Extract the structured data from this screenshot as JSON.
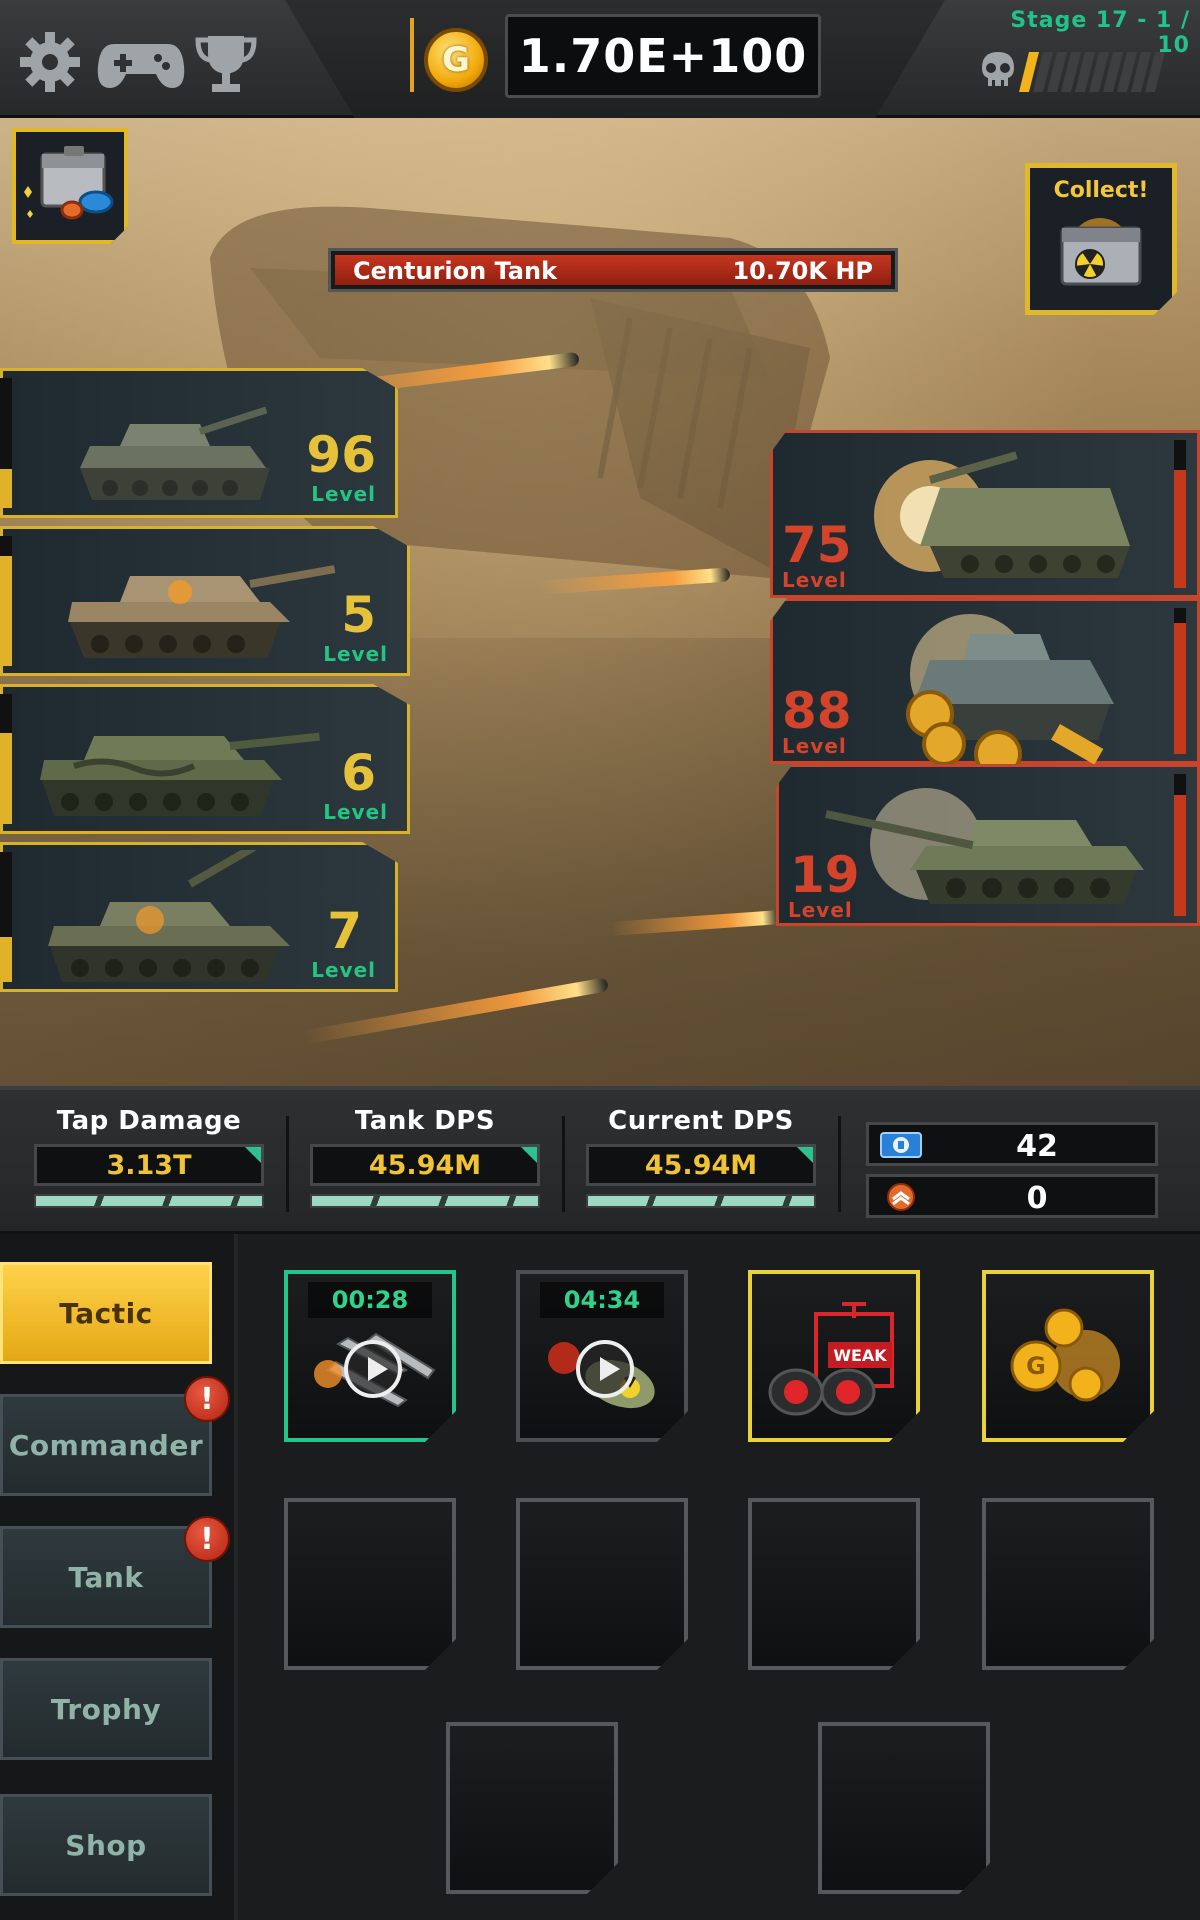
{
  "topbar": {
    "icons": [
      "gear-icon",
      "gamepad-icon",
      "trophy-icon"
    ],
    "coin_letter": "G",
    "gold_amount": "1.70E+100",
    "stage": "Stage 17 - 1 / 10",
    "wave_progress": 0.1,
    "accent_color": "#f2b31b"
  },
  "battle": {
    "collect_label": "Collect!",
    "enemy": {
      "name": "Centurion Tank",
      "hp": "10.70K HP",
      "hp_fraction": 1.0
    },
    "player_tanks": [
      {
        "level": "96",
        "level_word": "Level",
        "charge": 0.3
      },
      {
        "level": "5",
        "level_word": "Level",
        "charge": 0.85
      },
      {
        "level": "6",
        "level_word": "Level",
        "charge": 0.7
      },
      {
        "level": "7",
        "level_word": "Level",
        "charge": 0.35
      }
    ],
    "enemy_tanks": [
      {
        "level": "75",
        "level_word": "Level",
        "charge": 0.8
      },
      {
        "level": "88",
        "level_word": "Level",
        "charge": 0.9
      },
      {
        "level": "19",
        "level_word": "Level",
        "charge": 0.85
      }
    ]
  },
  "stats": {
    "tap_damage": {
      "label": "Tap Damage",
      "value": "3.13T"
    },
    "tank_dps": {
      "label": "Tank DPS",
      "value": "45.94M"
    },
    "current_dps": {
      "label": "Current DPS",
      "value": "45.94M"
    },
    "resources": [
      {
        "icon": "blue-ticket-icon",
        "value": "42"
      },
      {
        "icon": "orange-medal-icon",
        "value": "0"
      }
    ]
  },
  "nav": {
    "tabs": [
      {
        "label": "Tactic",
        "active": true,
        "alert": false
      },
      {
        "label": "Commander",
        "active": false,
        "alert": true
      },
      {
        "label": "Tank",
        "active": false,
        "alert": true
      },
      {
        "label": "Trophy",
        "active": false,
        "alert": false
      },
      {
        "label": "Shop",
        "active": false,
        "alert": false
      }
    ],
    "alert_symbol": "!"
  },
  "tactics": {
    "slots": [
      {
        "kind": "missile-barrage",
        "timer": "00:28",
        "state": "video-ready"
      },
      {
        "kind": "nuke-strike",
        "timer": "04:34",
        "state": "video-cooldown"
      },
      {
        "kind": "weak-spot-binoculars",
        "badge": "WEAK",
        "state": "ready"
      },
      {
        "kind": "gold-coins",
        "state": "ready"
      }
    ],
    "empty_slots": 6
  }
}
